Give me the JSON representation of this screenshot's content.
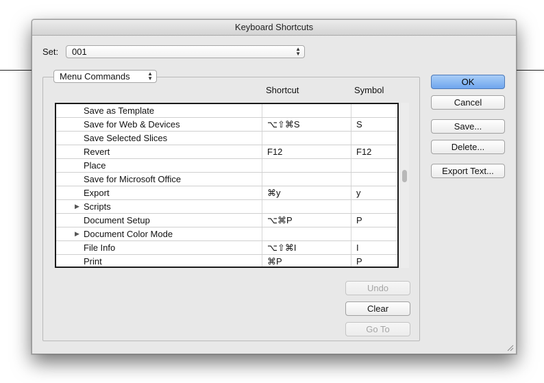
{
  "window": {
    "title": "Keyboard Shortcuts"
  },
  "set": {
    "label": "Set:",
    "value": "001"
  },
  "category": {
    "value": "Menu Commands"
  },
  "columns": {
    "shortcut": "Shortcut",
    "symbol": "Symbol"
  },
  "rows": [
    {
      "name": "Save as Template",
      "shortcut": "",
      "symbol": "",
      "expandable": false
    },
    {
      "name": "Save for Web & Devices",
      "shortcut": "⌥⇧⌘S",
      "symbol": "S",
      "expandable": false
    },
    {
      "name": "Save Selected Slices",
      "shortcut": "",
      "symbol": "",
      "expandable": false
    },
    {
      "name": "Revert",
      "shortcut": "F12",
      "symbol": "F12",
      "expandable": false
    },
    {
      "name": "Place",
      "shortcut": "",
      "symbol": "",
      "expandable": false
    },
    {
      "name": "Save for Microsoft Office",
      "shortcut": "",
      "symbol": "",
      "expandable": false
    },
    {
      "name": "Export",
      "shortcut": "⌘y",
      "symbol": "y",
      "expandable": false
    },
    {
      "name": "Scripts",
      "shortcut": "",
      "symbol": "",
      "expandable": true
    },
    {
      "name": "Document Setup",
      "shortcut": "⌥⌘P",
      "symbol": "P",
      "expandable": false
    },
    {
      "name": "Document Color Mode",
      "shortcut": "",
      "symbol": "",
      "expandable": true
    },
    {
      "name": "File Info",
      "shortcut": "⌥⇧⌘I",
      "symbol": "I",
      "expandable": false
    },
    {
      "name": "Print",
      "shortcut": "⌘P",
      "symbol": "P",
      "expandable": false
    }
  ],
  "buttons": {
    "ok": "OK",
    "cancel": "Cancel",
    "save": "Save...",
    "delete": "Delete...",
    "export_text": "Export Text...",
    "undo": "Undo",
    "clear": "Clear",
    "go_to": "Go To"
  },
  "icons": {
    "expand": "disclosure-triangle-icon",
    "select_arrows": "up-down-arrows-icon",
    "resize": "resize-grip-icon"
  }
}
